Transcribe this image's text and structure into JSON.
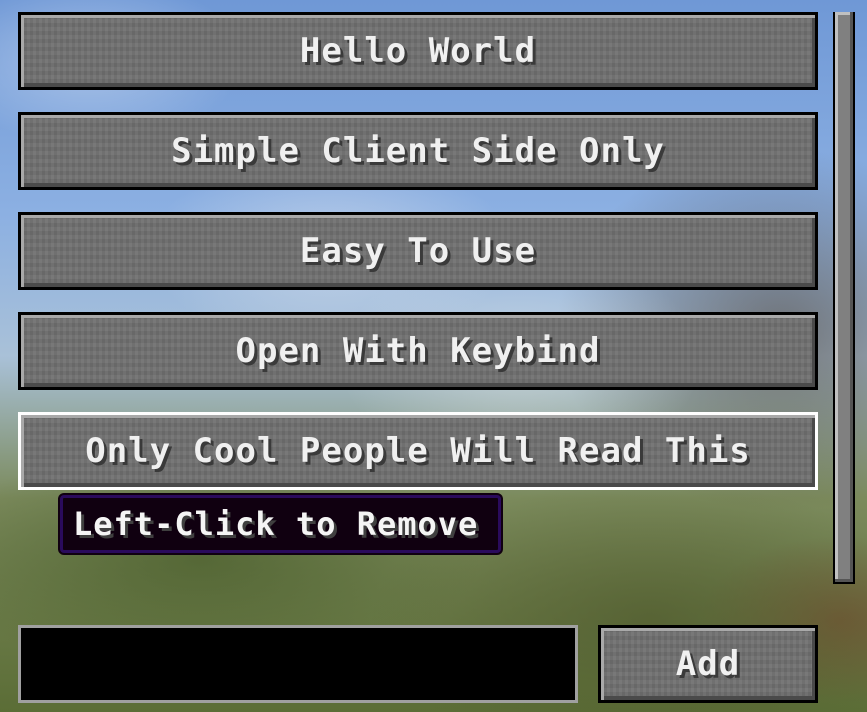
{
  "list": {
    "items": [
      {
        "label": "Hello World"
      },
      {
        "label": "Simple Client Side Only"
      },
      {
        "label": "Easy To Use"
      },
      {
        "label": "Open With Keybind"
      },
      {
        "label": "Only Cool People Will Read This"
      }
    ]
  },
  "tooltip": {
    "text": "Left-Click to Remove"
  },
  "input": {
    "value": "",
    "placeholder": ""
  },
  "add_button": {
    "label": "Add"
  },
  "colors": {
    "button_bg": "#6f6f6f",
    "hover_border": "#ffffff",
    "tooltip_border": "#2a0b5c"
  }
}
